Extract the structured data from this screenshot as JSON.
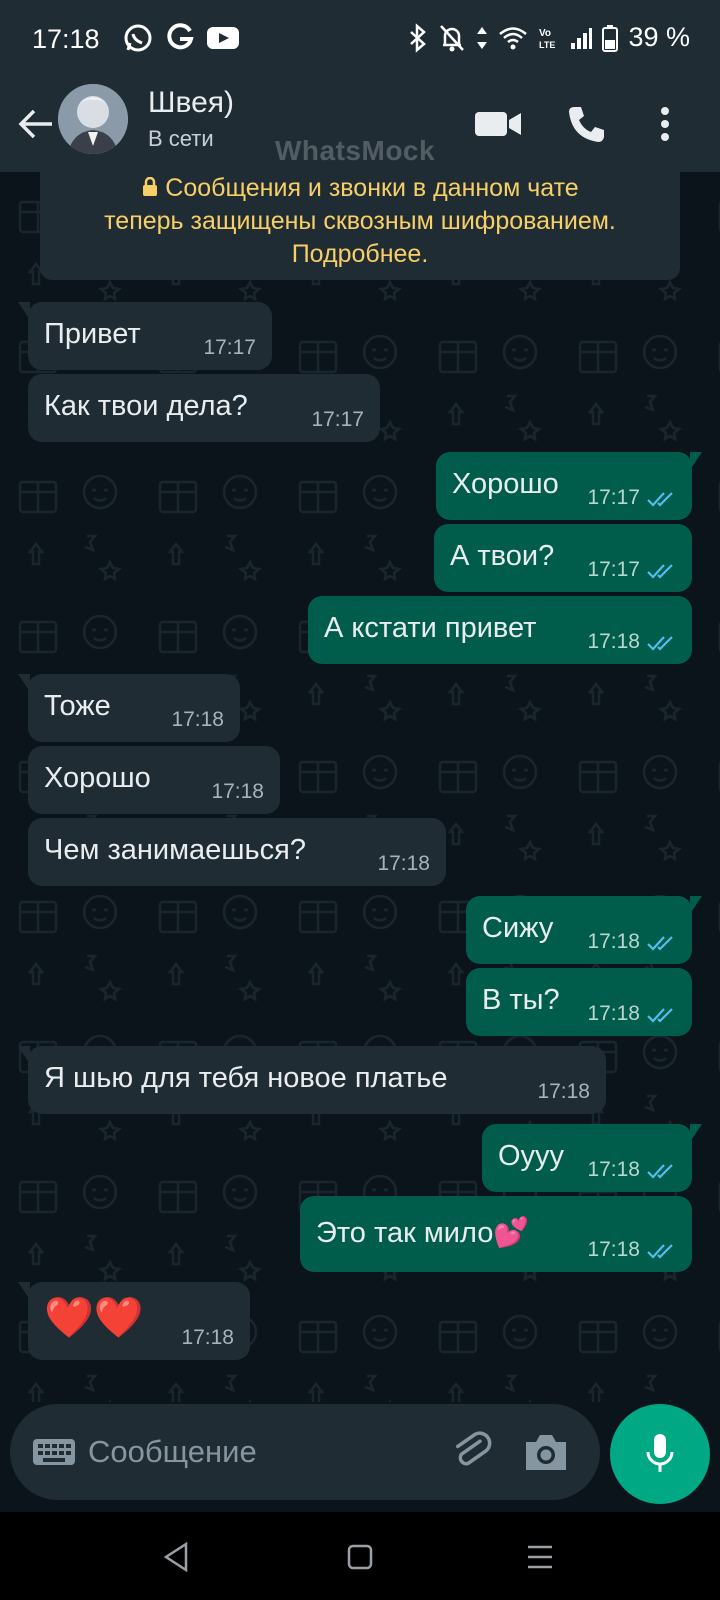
{
  "status_bar": {
    "time": "17:18",
    "left_icons": [
      "whatsapp-icon",
      "google-icon",
      "youtube-icon"
    ],
    "right_icons": [
      "bluetooth-icon",
      "mute-icon",
      "data-arrows-icon",
      "wifi-icon",
      "volte-icon",
      "signal-icon",
      "battery-icon"
    ],
    "battery": "39 %"
  },
  "header": {
    "contact_name": "Швея)",
    "status": "В сети",
    "watermark": "WhatsMock",
    "icons": [
      "back-arrow-icon",
      "video-call-icon",
      "phone-call-icon",
      "more-vert-icon"
    ]
  },
  "encryption_notice": {
    "line1": "Сообщения и звонки в данном чате",
    "line2": "теперь защищены сквозным шифрованием.",
    "line3": "Подробнее."
  },
  "messages": [
    {
      "direction": "in",
      "text": "Привет",
      "time": "17:17"
    },
    {
      "direction": "in",
      "text": "Как твои дела?",
      "time": "17:17"
    },
    {
      "direction": "out",
      "text": "Хорошо",
      "time": "17:17",
      "read": true
    },
    {
      "direction": "out",
      "text": "А твои?",
      "time": "17:17",
      "read": true
    },
    {
      "direction": "out",
      "text": "А кстати привет",
      "time": "17:18",
      "read": true
    },
    {
      "direction": "in",
      "text": "Тоже",
      "time": "17:18"
    },
    {
      "direction": "in",
      "text": "Хорошо",
      "time": "17:18"
    },
    {
      "direction": "in",
      "text": "Чем занимаешься?",
      "time": "17:18"
    },
    {
      "direction": "out",
      "text": "Сижу",
      "time": "17:18",
      "read": true
    },
    {
      "direction": "out",
      "text": "В ты?",
      "time": "17:18",
      "read": true
    },
    {
      "direction": "in",
      "text": "Я шью для тебя новое платье",
      "time": "17:18"
    },
    {
      "direction": "out",
      "text": "Оууу",
      "time": "17:18",
      "read": true
    },
    {
      "direction": "out",
      "text": "Это так мило💕",
      "time": "17:18",
      "read": true
    },
    {
      "direction": "in",
      "text": "❤️❤️",
      "time": "17:18"
    }
  ],
  "input": {
    "placeholder": "Сообщение"
  },
  "colors": {
    "background": "#0b141a",
    "header": "#1f2c34",
    "incoming_bubble": "#1f2c34",
    "outgoing_bubble": "#005c4b",
    "read_ticks": "#53bdeb",
    "accent": "#00a884",
    "notice_text": "#f8cf66"
  }
}
